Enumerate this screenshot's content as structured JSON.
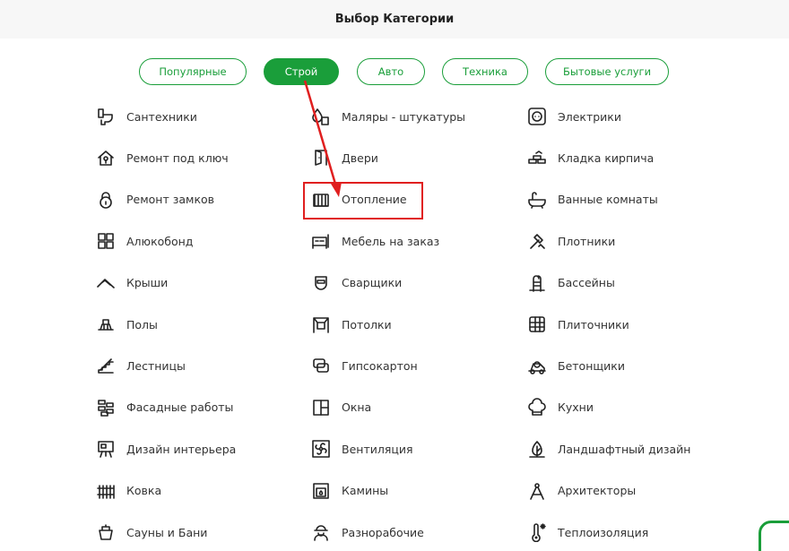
{
  "header": {
    "title": "Выбор Категории"
  },
  "tabs": [
    {
      "label": "Популярные",
      "active": false
    },
    {
      "label": "Строй",
      "active": true
    },
    {
      "label": "Авто",
      "active": false
    },
    {
      "label": "Техника",
      "active": false
    },
    {
      "label": "Бытовые услуги",
      "active": false
    }
  ],
  "columns": [
    [
      {
        "label": "Сантехники",
        "icon": "toilet-icon"
      },
      {
        "label": "Ремонт под ключ",
        "icon": "house-key-icon"
      },
      {
        "label": "Ремонт замков",
        "icon": "padlock-icon"
      },
      {
        "label": "Алюкобонд",
        "icon": "panels-grid-icon"
      },
      {
        "label": "Крыши",
        "icon": "roof-icon"
      },
      {
        "label": "Полы",
        "icon": "floor-icon"
      },
      {
        "label": "Лестницы",
        "icon": "stairs-icon"
      },
      {
        "label": "Фасадные работы",
        "icon": "facade-bricks-icon"
      },
      {
        "label": "Дизайн интерьера",
        "icon": "easel-icon"
      },
      {
        "label": "Ковка",
        "icon": "fence-icon"
      },
      {
        "label": "Сауны и Бани",
        "icon": "sauna-bucket-icon"
      }
    ],
    [
      {
        "label": "Маляры - штукатуры",
        "icon": "paint-drop-icon"
      },
      {
        "label": "Двери",
        "icon": "door-icon"
      },
      {
        "label": "Отопление",
        "icon": "radiator-icon"
      },
      {
        "label": "Мебель на заказ",
        "icon": "bed-icon"
      },
      {
        "label": "Сварщики",
        "icon": "welding-mask-icon"
      },
      {
        "label": "Потолки",
        "icon": "ceiling-icon"
      },
      {
        "label": "Гипсокартон",
        "icon": "drywall-sheets-icon"
      },
      {
        "label": "Окна",
        "icon": "window-icon"
      },
      {
        "label": "Вентиляция",
        "icon": "fan-icon"
      },
      {
        "label": "Камины",
        "icon": "fireplace-icon"
      },
      {
        "label": "Разнорабочие",
        "icon": "worker-icon"
      }
    ],
    [
      {
        "label": "Электрики",
        "icon": "socket-icon"
      },
      {
        "label": "Кладка кирпича",
        "icon": "bricks-icon"
      },
      {
        "label": "Ванные комнаты",
        "icon": "bathtub-icon"
      },
      {
        "label": "Плотники",
        "icon": "hammer-icon"
      },
      {
        "label": "Бассейны",
        "icon": "pool-ladder-icon"
      },
      {
        "label": "Плиточники",
        "icon": "tiles-icon"
      },
      {
        "label": "Бетонщики",
        "icon": "concrete-mixer-icon"
      },
      {
        "label": "Кухни",
        "icon": "chef-hat-icon"
      },
      {
        "label": "Ландшафтный дизайн",
        "icon": "tree-icon"
      },
      {
        "label": "Архитекторы",
        "icon": "compass-icon"
      },
      {
        "label": "Теплоизоляция",
        "icon": "thermometer-icon"
      }
    ]
  ],
  "colors": {
    "accent": "#1a9e3a",
    "annotation": "#e01f1f"
  }
}
